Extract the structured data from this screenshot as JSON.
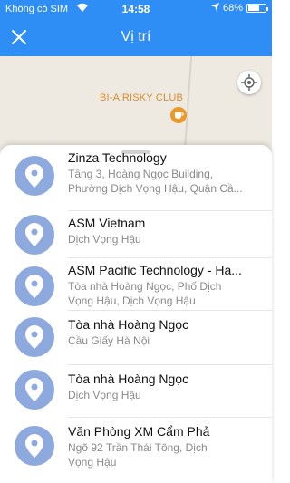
{
  "status": {
    "carrier": "Không có SIM",
    "time": "14:58",
    "battery": "68%",
    "battery_level": 0.68
  },
  "nav": {
    "title": "Vị trí",
    "close_icon": "close-icon"
  },
  "map": {
    "poi_label": "BI-A RISKY CLUB"
  },
  "places": [
    {
      "name": "Zinza Technology",
      "address_line1": "Tầng 3, Hoàng Ngọc Building,",
      "address_line2": "Phường Dịch Vọng Hậu, Quận Cầ..."
    },
    {
      "name": "ASM Vietnam",
      "address_line1": "Dịch Vọng Hậu",
      "address_line2": ""
    },
    {
      "name": "ASM Pacific Technology - Ha...",
      "address_line1": "Tòa nhà Hoàng Ngọc, Phố Dịch",
      "address_line2": "Vọng Hậu, Dịch Vọng Hậu"
    },
    {
      "name": "Tòa nhà Hoàng Ngọc",
      "address_line1": "Cầu Giấy Hà Nội",
      "address_line2": ""
    },
    {
      "name": "Tòa nhà Hoàng Ngọc",
      "address_line1": "Dịch Vọng Hậu",
      "address_line2": ""
    },
    {
      "name": "Văn Phòng XM Cẩm Phả",
      "address_line1": "Ngõ 92 Trần Thái Tông, Dịch",
      "address_line2": "Vọng Hậu"
    }
  ],
  "colors": {
    "header": "#2f8ef5",
    "pin_bg": "#8ea9dd",
    "poi": "#d98b2b"
  }
}
